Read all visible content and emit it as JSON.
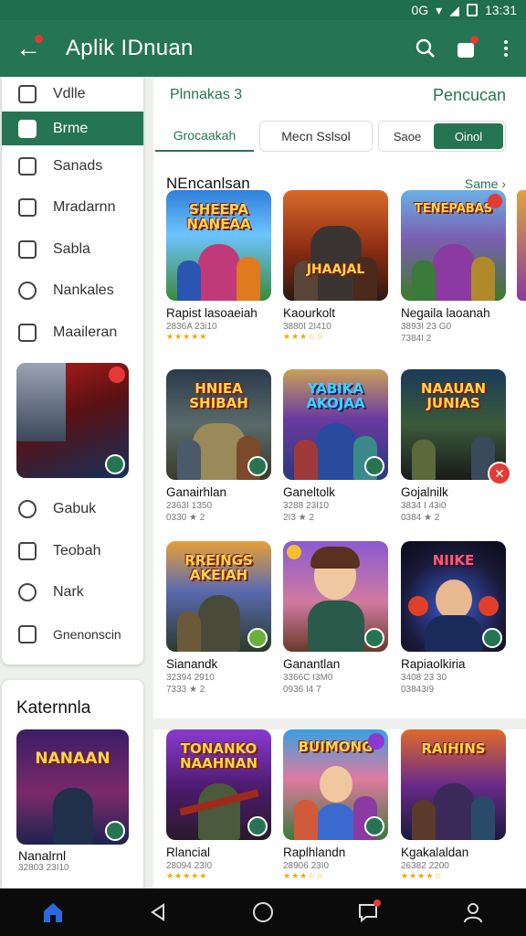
{
  "status": {
    "time": "13:31",
    "net": "0G"
  },
  "appbar": {
    "title": "Aplik IDnuan"
  },
  "sidebar": {
    "items": [
      {
        "label": "Vdlle",
        "icon": "library-icon"
      },
      {
        "label": "Brme",
        "icon": "home-icon",
        "active": true
      },
      {
        "label": "Sanads",
        "icon": "bag-icon"
      },
      {
        "label": "Mradarnn",
        "icon": "gamepad-icon"
      },
      {
        "label": "Sabla",
        "icon": "file-icon"
      },
      {
        "label": "Nankales",
        "icon": "search-icon"
      }
    ],
    "items2": [
      {
        "label": "Maaileran",
        "icon": "folder-icon"
      }
    ],
    "items3": [
      {
        "label": "Gabuk",
        "icon": "compass-icon"
      },
      {
        "label": "Teobah",
        "icon": "list-icon"
      },
      {
        "label": "Nark",
        "icon": "shield-icon"
      },
      {
        "label": "Gnenonscin",
        "icon": "camera-icon"
      }
    ]
  },
  "category": {
    "title": "Katernnla",
    "game": {
      "name": "Nanalrnl",
      "meta": "32803 23I10",
      "logo": "NANAAN"
    }
  },
  "main": {
    "head_left": "Plnnakas 3",
    "head_right": "Pencucan",
    "tabs": {
      "t1": "Grocaakah",
      "t2": "Mecn Sslsol",
      "t3_sub": "Saoe",
      "t3_on": "Oinol"
    },
    "section_title": "NEncanlsan",
    "section_more": "Same"
  },
  "games": [
    {
      "name": "Rapist lasoaeiah",
      "meta": "2836A 23i10",
      "meta2": "",
      "stars": "★★★★★",
      "logo": "SHEEPA NANEAA"
    },
    {
      "name": "Kaourkolt",
      "meta": "3880I 2I410",
      "meta2": "",
      "stars": "★★★☆☆",
      "logo": "JHAAJAL"
    },
    {
      "name": "Negaila laoanah",
      "meta": "3893I 23 G0",
      "meta2": "7384I 2",
      "stars": "",
      "logo": "TENEPABAS"
    },
    {
      "name": "Ganairhlan",
      "meta": "2363I 1350",
      "meta2": "0330 ★ 2",
      "stars": "",
      "logo": "HNIEA SHIBAH"
    },
    {
      "name": "Ganeltolk",
      "meta": "3288 23I10",
      "meta2": "2I3 ★ 2",
      "stars": "",
      "logo": "YABIKA AKOJAA"
    },
    {
      "name": "Gojalnilk",
      "meta": "3834 I 43i0",
      "meta2": "0384 ★ 2",
      "stars": "",
      "logo": "NAAUAN JUNIAS"
    },
    {
      "name": "Sianandk",
      "meta": "32394 2910",
      "meta2": "7333 ★ 2",
      "stars": "",
      "logo": "RREINGS AKEIAH"
    },
    {
      "name": "Ganantlan",
      "meta": "3366C I3M0",
      "meta2": "0936 I4 7",
      "stars": "",
      "logo": ""
    },
    {
      "name": "Rapiaolkiria",
      "meta": "3408 23 30",
      "meta2": "03843I9",
      "stars": "",
      "logo": "NIIKE"
    },
    {
      "name": "Rlancial",
      "meta": "28094 23I0",
      "meta2": "",
      "stars": "★★★★★",
      "logo": "TONANKO NAAHNAN"
    },
    {
      "name": "Raplhlandn",
      "meta": "28906 23I0",
      "meta2": "",
      "stars": "★★★☆☆",
      "logo": "BUIMONG"
    },
    {
      "name": "Kgakalaldan",
      "meta": "26382 2200",
      "meta2": "",
      "stars": "★★★★☆",
      "logo": "RAIHINS"
    }
  ]
}
